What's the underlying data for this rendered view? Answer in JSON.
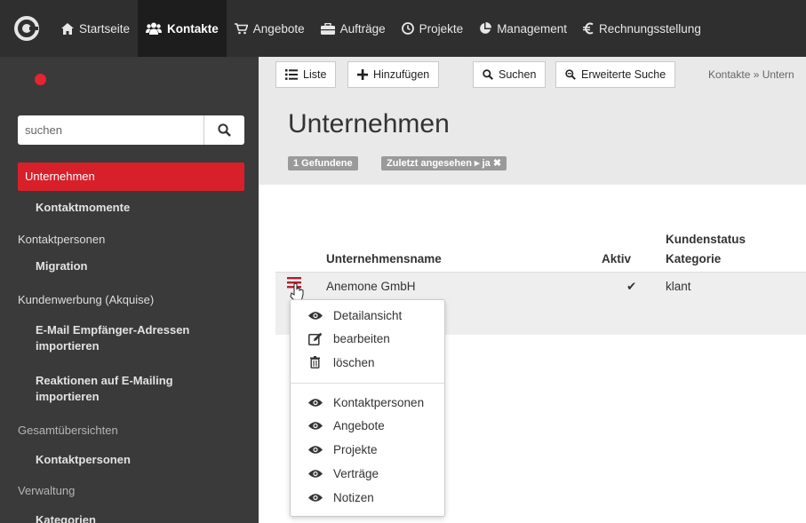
{
  "nav": {
    "items": [
      {
        "label": "Startseite",
        "icon": "home-icon"
      },
      {
        "label": "Kontakte",
        "icon": "users-icon"
      },
      {
        "label": "Angebote",
        "icon": "cart-icon"
      },
      {
        "label": "Aufträge",
        "icon": "briefcase-icon"
      },
      {
        "label": "Projekte",
        "icon": "clock-icon"
      },
      {
        "label": "Management",
        "icon": "pie-chart-icon"
      },
      {
        "label": "Rechnungsstellung",
        "icon": "euro-icon"
      }
    ],
    "active": "Kontakte"
  },
  "sidebar": {
    "search_placeholder": "suchen",
    "items": [
      {
        "label": "Unternehmen"
      },
      {
        "label": "Kontaktmomente"
      },
      {
        "label": "Kontaktpersonen"
      },
      {
        "label": "Migration"
      },
      {
        "label": "Kundenwerbung (Akquise)"
      },
      {
        "label": "E-Mail Empfänger-Adressen"
      },
      {
        "label": "importieren"
      },
      {
        "label": "Reaktionen auf E-Mailing"
      },
      {
        "label": "importieren"
      },
      {
        "label": "Gesamtübersichten"
      },
      {
        "label": "Kontaktpersonen"
      },
      {
        "label": "Verwaltung"
      },
      {
        "label": "Kategorien"
      }
    ]
  },
  "toolbar": {
    "list_label": "Liste",
    "add_label": "Hinzufügen",
    "search_label": "Suchen",
    "advanced_label": "Erweiterte Suche",
    "breadcrumb": "Kontakte » Untern"
  },
  "page": {
    "title": "Unternehmen",
    "badge_found": "1 Gefundene",
    "badge_filter": "Zuletzt angesehen ▸ ja  ✖"
  },
  "table": {
    "col_name": "Unternehmensname",
    "col_active": "Aktiv",
    "col_status_1": "Kundenstatus",
    "col_status_2": "Kategorie",
    "rows": [
      {
        "name": "Anemone GmbH",
        "active": "✔",
        "status": "klant"
      }
    ]
  },
  "dropdown": {
    "items": [
      {
        "label": "Detailansicht",
        "icon": "eye-icon"
      },
      {
        "label": "bearbeiten",
        "icon": "edit-icon"
      },
      {
        "label": "löschen",
        "icon": "trash-icon"
      },
      {
        "label": "Kontaktpersonen",
        "icon": "eye-icon"
      },
      {
        "label": "Angebote",
        "icon": "eye-icon"
      },
      {
        "label": "Projekte",
        "icon": "eye-icon"
      },
      {
        "label": "Verträge",
        "icon": "eye-icon"
      },
      {
        "label": "Notizen",
        "icon": "eye-icon"
      }
    ]
  },
  "colors": {
    "accent": "#d8202b",
    "nav_bg": "#2f2f2f",
    "sidebar_bg": "#3a3a3a"
  }
}
